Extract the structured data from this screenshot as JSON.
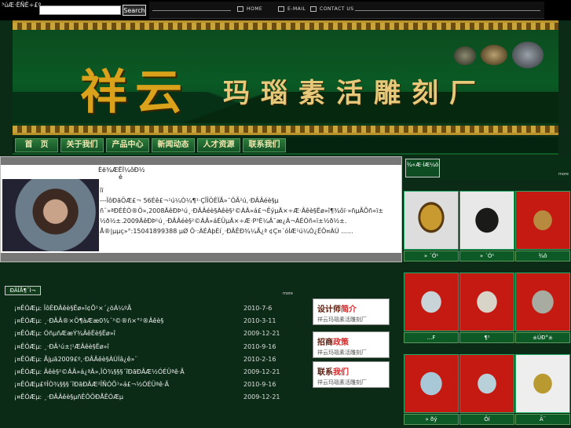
{
  "search": {
    "label": "³úÆ·ËÑË÷£º",
    "value": "",
    "button": "Search"
  },
  "topnav": {
    "home": "HOME",
    "email": "E-MAIL",
    "contact": "CONTACT US"
  },
  "banner": {
    "brand_big": "祥云",
    "brand_sub": "玛瑙素活雕刻厂"
  },
  "mainnav": [
    "首　页",
    "关于我们",
    "产品中心",
    "新闻动态",
    "人才资源",
    "联系我们"
  ],
  "about": {
    "title": "Èë¾ÆËÏ¼ôÐ½",
    "title2": "é",
    "text": "ïï\n---ÏôÐãÖÆ£¬ 56Éê£¬¹ú¼Ò¼¶¹·ÇÎÎÖÊÏÃ»¯ÔÃ²ú,·ÐÂÂéè§µ\nñ¨»ªÐÉÈÒ®Ö»,2008ÄêÐÞ¹ú¸·ÐÂÂéè§Àêè§²©ÁÂ»á£¬ÊýµÄ×÷Æ·Âêè§Ëø»î¶¾ôï·»ñµÃÕñ«ï±\n½ð½±.2009ÄêÐÞ¹ú¸·ÐÂÂéè§²©ÁÂ»áÉÜµÄ×÷Æ·P³È¼Â¯æ¿Á¬ÁÉÓñ«ï±½ð½±.\nÅ®|µµç»°:15041899388 µØ Ö·:ÀÉÀþÈí¸·ÐÂÊÐ¾¼Ã¿ª ¢Ç¤´óÍÆ¹ú¼Ò¿ËÖ¤ÀÚ ......"
  },
  "products": {
    "tab": "¾«Æ·ÍÆ¼ö",
    "more": "more",
    "items": [
      "» ´Ó¹",
      "» ´Ó¹",
      "¾ô",
      "...F",
      "¶¹",
      "±ÚÐ°±",
      "» ðý",
      "Ôí",
      "Ã¨"
    ]
  },
  "news": {
    "tab": "ÐÂÎÅ¶¯Ì¬",
    "more": "more",
    "items": [
      {
        "title": "¡¤ÊÓÆµ: ÎôÊÐÂêè§Ëø»î¢Õ¹×´¿öÁ¼ºÃ",
        "date": "2010-7-6"
      },
      {
        "title": "¡¤ÊÓÆµ: ¸·ÐÂÂ®×Ö¶àÆæ0¾´³©®ñ×°²®Âêè§",
        "date": "2010-3-11"
      },
      {
        "title": "¡¤ÊÓÆµ: ÓñµñÆæÝ¾ÂêËè§Ëø»î",
        "date": "2009-12-21"
      },
      {
        "title": "¡¤ÊÓÆµ: ¸·ÐÂ¹ú±¦¹ÆÂêè§Ëø»î",
        "date": "2010-9-16"
      },
      {
        "title": "¡¤ÊÓÆµ: Ãjµã2009£º,·ÐÂÂêè§ÀÚÍâ¿ê»¨",
        "date": "2010-2-16"
      },
      {
        "title": "¡¤ÊÓÆµ: Âêè§²©ÁÂ»á¿ªÄ»,ÎÒ¾§§§´îÐãÐÂÆ½ÓÉÜªê·Ã",
        "date": "2009-12-21"
      },
      {
        "title": "¡¤ÊÓÆµ£ºÎÒ¾§§§´îÐãÐÂÆ²ÎÑÓÕ¹»á£¬½ÓÉÜªê·Ã",
        "date": "2010-9-16"
      },
      {
        "title": "¡¤ÊÓÆµ: ¸·ÐÂÂêè§µñÊÔÖÐÅÊÓÆµ",
        "date": "2009-12-21"
      }
    ]
  },
  "cards": [
    {
      "head_a": "设计师",
      "head_b": "简介",
      "sub": "祥云玛瑙素活雕刻厂"
    },
    {
      "head_a": "招商",
      "head_b": "政策",
      "sub": "祥云玛瑙素活雕刻厂"
    },
    {
      "head_a": "联系",
      "head_b": "我们",
      "sub": "祥云玛瑙素活雕刻厂"
    }
  ],
  "colors": {
    "bg": "#0b2b16",
    "gold": "#d9a21a",
    "green": "#0e5a26"
  }
}
